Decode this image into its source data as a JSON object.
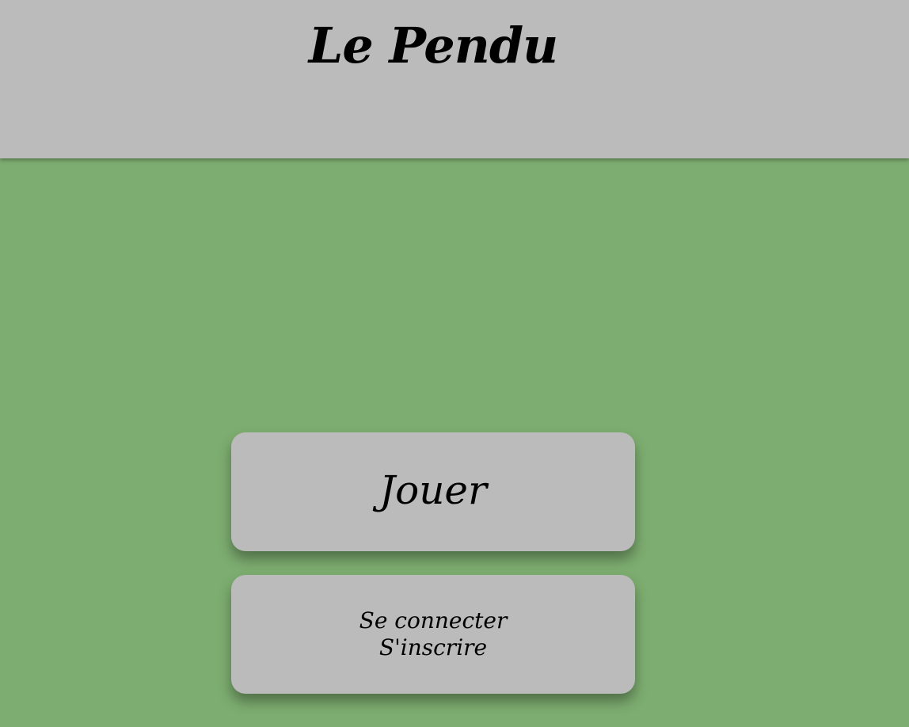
{
  "header": {
    "title": "Le Pendu"
  },
  "main": {
    "play_label": "Jouer",
    "auth": {
      "login_label": "Se connecter",
      "signup_label": "S'inscrire"
    }
  },
  "colors": {
    "background": "#7dad70",
    "header": "#bbbbbb",
    "button": "#bbbbbb",
    "text": "#000000"
  }
}
